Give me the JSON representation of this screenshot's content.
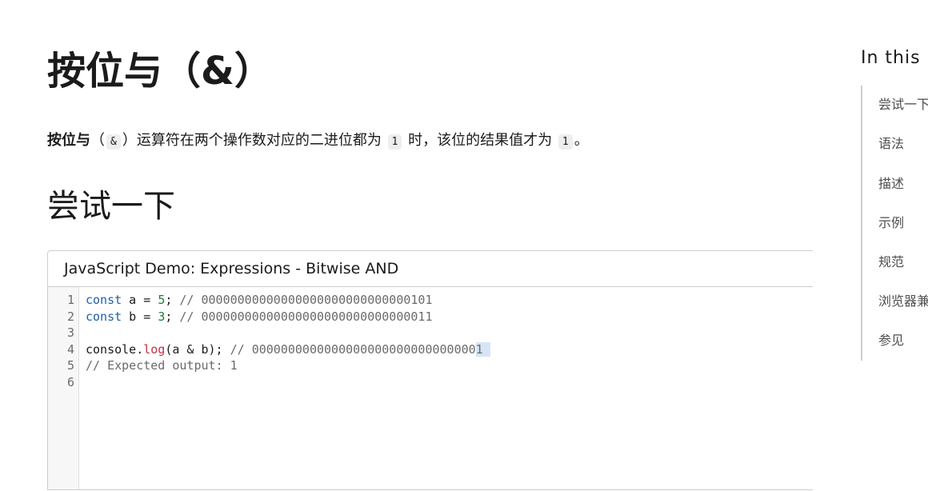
{
  "article": {
    "title": "按位与（&）",
    "intro": {
      "strong": "按位与",
      "paren_open": "（",
      "operator": "&",
      "paren_close": "）",
      "text1": "运算符在两个操作数对应的二进位都为",
      "value1": "1",
      "text2": "时，该位的结果值才为",
      "value2": "1",
      "end": "。"
    },
    "section_heading": "尝试一下"
  },
  "demo": {
    "title": "JavaScript Demo: Expressions - Bitwise AND",
    "line_numbers": [
      "1",
      "2",
      "3",
      "4",
      "5",
      "6"
    ],
    "lines": [
      {
        "kw": "const",
        "ident": " a = ",
        "num": "5",
        "rest": "; ",
        "comment": "// 00000000000000000000000000000101"
      },
      {
        "kw": "const",
        "ident": " b = ",
        "num": "3",
        "rest": "; ",
        "comment": "// 00000000000000000000000000000011"
      },
      {
        "text": ""
      },
      {
        "obj": "console.",
        "fn": "log",
        "args": "(a & b); ",
        "comment": "// 0000000000000000000000000000000",
        "selected": "1 "
      },
      {
        "comment": "// Expected output: 1"
      },
      {
        "text": ""
      }
    ]
  },
  "toc": {
    "title": "In this",
    "items": [
      "尝试一下",
      "语法",
      "描述",
      "示例",
      "规范",
      "浏览器兼",
      "参见"
    ]
  }
}
